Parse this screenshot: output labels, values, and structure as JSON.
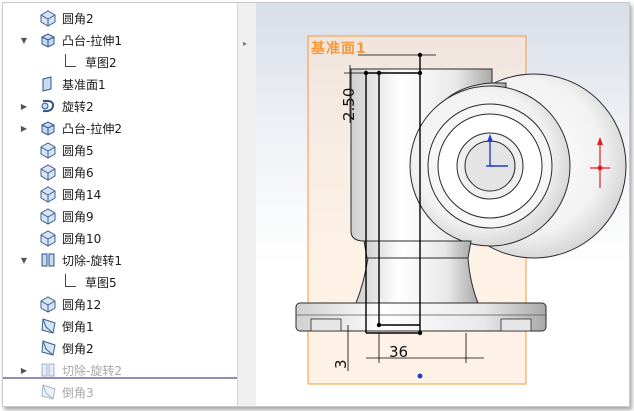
{
  "tree": {
    "items": [
      {
        "label": "圆角2",
        "icon": "fillet-icon",
        "expander": "",
        "dim": false
      },
      {
        "label": "凸台-拉伸1",
        "icon": "extrude-boss-icon",
        "expander": "▼",
        "dim": false
      },
      {
        "label": "草图2",
        "icon": "sketch-icon",
        "expander": "",
        "dim": false,
        "child": true
      },
      {
        "label": "基准面1",
        "icon": "plane-icon",
        "expander": "",
        "dim": false
      },
      {
        "label": "旋转2",
        "icon": "revolve-icon",
        "expander": "▶",
        "dim": false
      },
      {
        "label": "凸台-拉伸2",
        "icon": "extrude-boss-icon",
        "expander": "▶",
        "dim": false
      },
      {
        "label": "圆角5",
        "icon": "fillet-icon",
        "expander": "",
        "dim": false
      },
      {
        "label": "圆角6",
        "icon": "fillet-icon",
        "expander": "",
        "dim": false
      },
      {
        "label": "圆角14",
        "icon": "fillet-icon",
        "expander": "",
        "dim": false
      },
      {
        "label": "圆角9",
        "icon": "fillet-icon",
        "expander": "",
        "dim": false
      },
      {
        "label": "圆角10",
        "icon": "fillet-icon",
        "expander": "",
        "dim": false
      },
      {
        "label": "切除-旋转1",
        "icon": "cut-revolve-icon",
        "expander": "▼",
        "dim": false
      },
      {
        "label": "草图5",
        "icon": "sketch-icon",
        "expander": "",
        "dim": false,
        "child": true
      },
      {
        "label": "圆角12",
        "icon": "fillet-icon",
        "expander": "",
        "dim": false
      },
      {
        "label": "倒角1",
        "icon": "chamfer-icon",
        "expander": "",
        "dim": false
      },
      {
        "label": "倒角2",
        "icon": "chamfer-icon",
        "expander": "",
        "dim": false
      },
      {
        "label": "切除-旋转2",
        "icon": "cut-revolve-icon",
        "expander": "▶",
        "dim": true
      },
      {
        "label": "倒角3",
        "icon": "chamfer-icon",
        "expander": "",
        "dim": true
      }
    ]
  },
  "viewport": {
    "plane_label": "基准面1",
    "dim_top": "2.50",
    "dim_bottom_left": "3",
    "dim_bottom": "36",
    "colors": {
      "plane": "#f39a3c",
      "triad_blue": "#1c3fd6",
      "triad_red": "#e02020"
    }
  }
}
